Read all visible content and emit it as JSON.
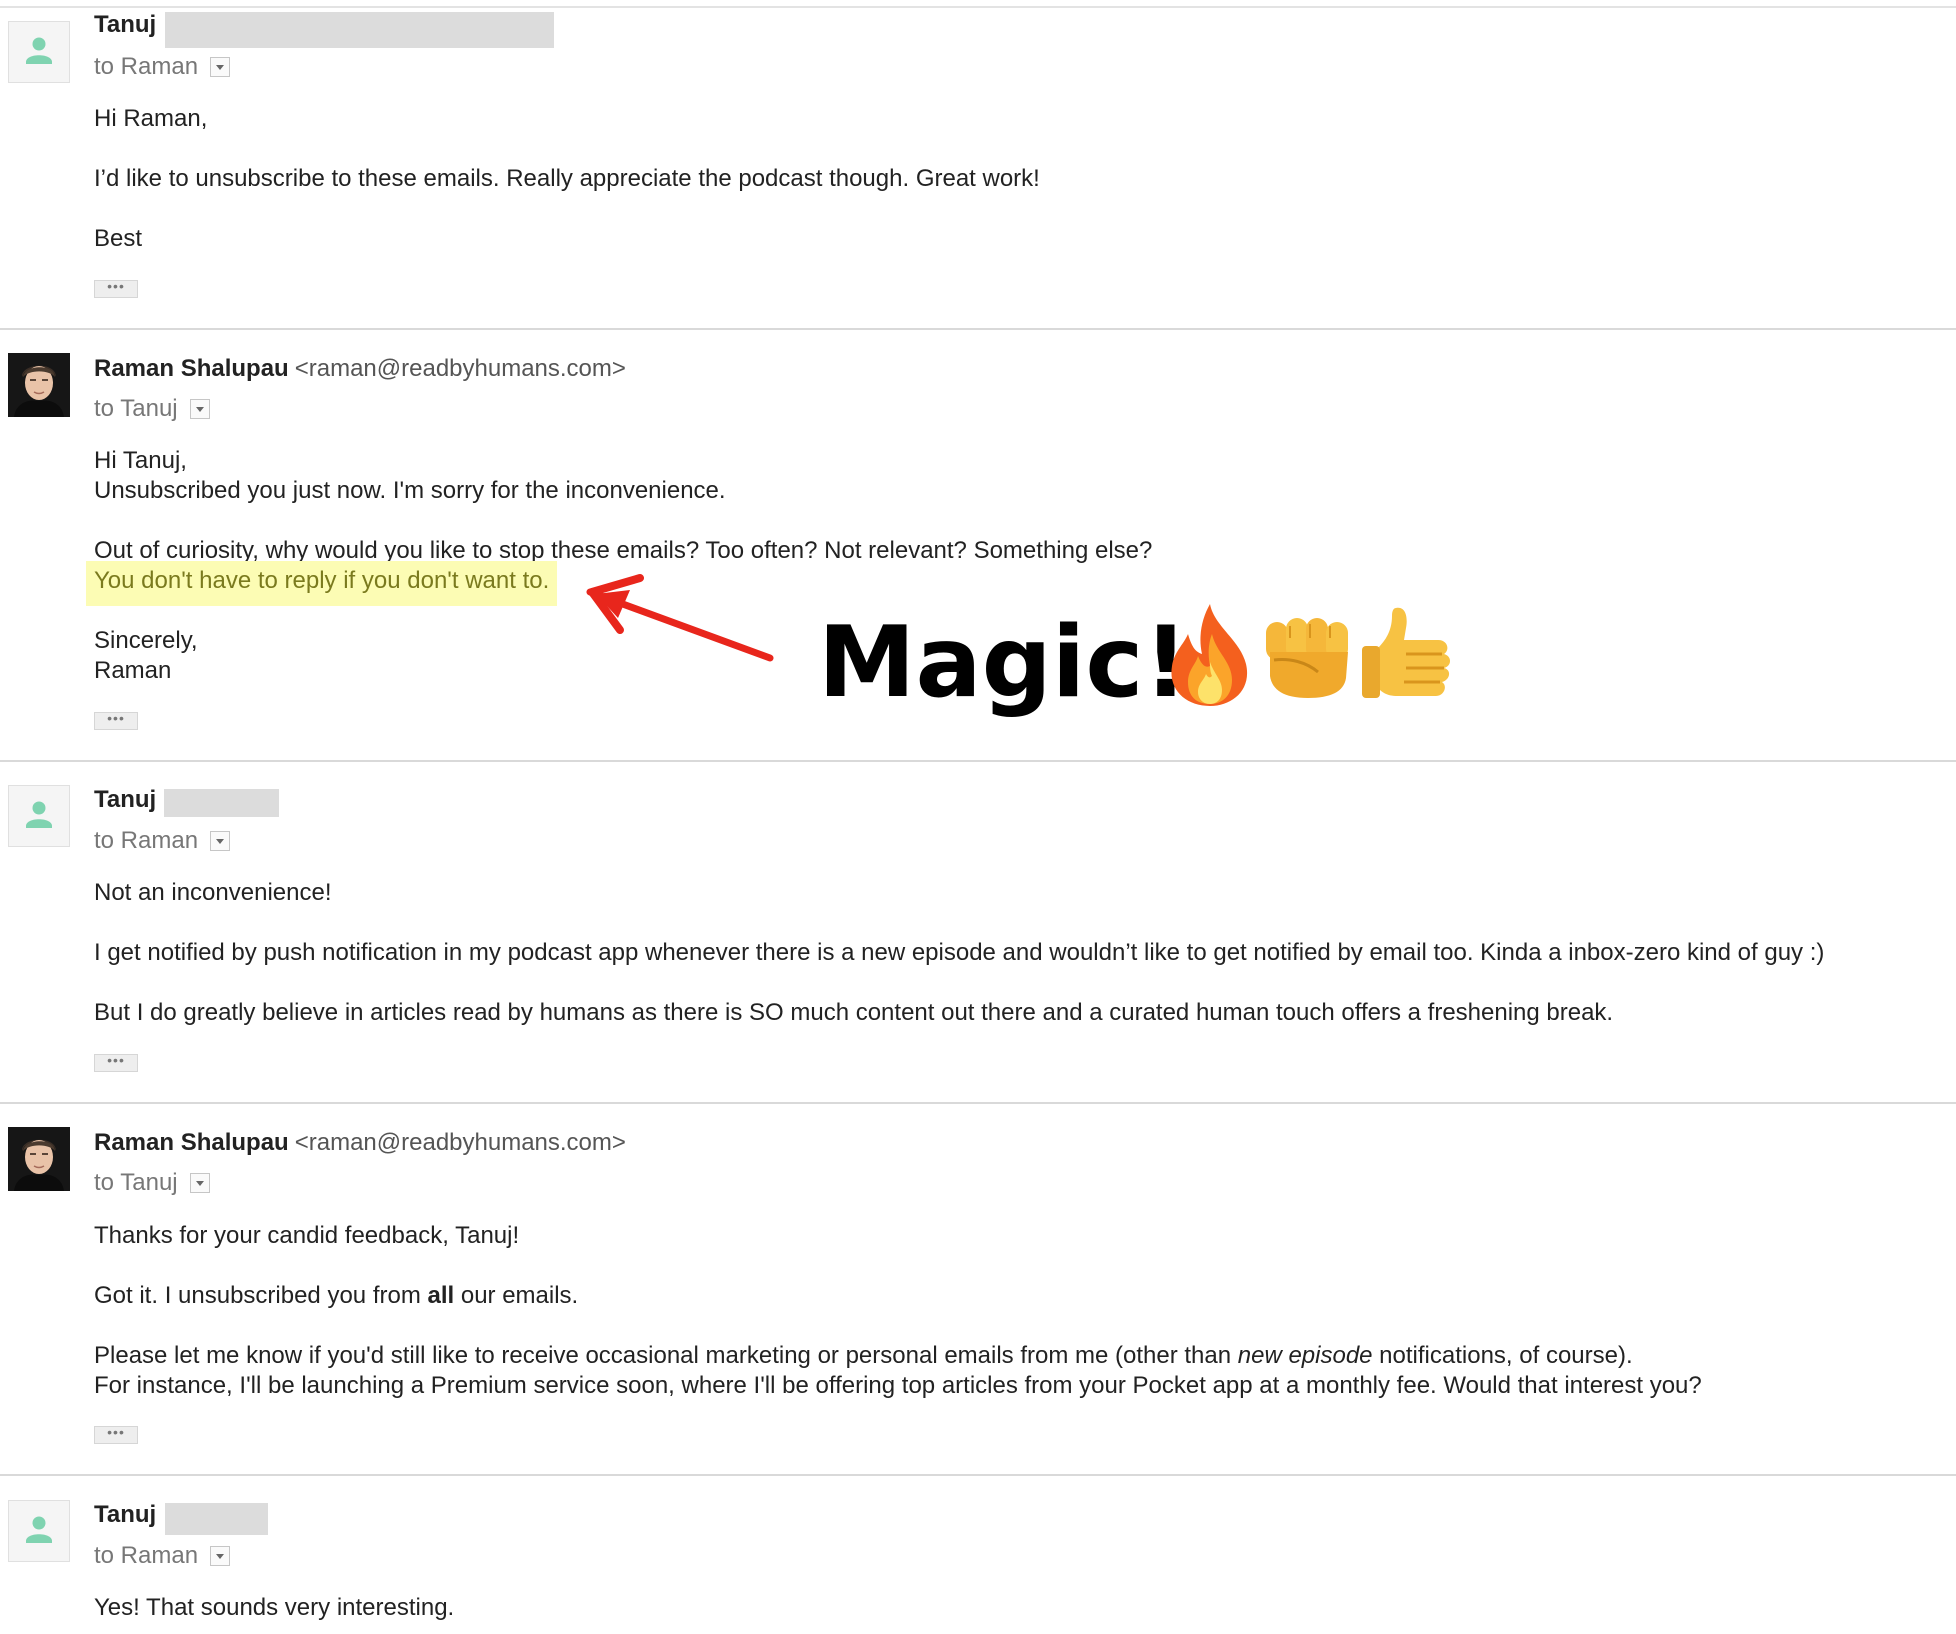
{
  "messages": [
    {
      "sender_name": "Tanuj",
      "sender_email": "",
      "to": "to Raman",
      "body": [
        "Hi Raman,",
        "I’d like to unsubscribe to these emails. Really appreciate the podcast though. Great work!",
        "Best"
      ]
    },
    {
      "sender_name": "Raman Shalupau",
      "sender_email": "<raman@readbyhumans.com>",
      "to": "to Tanuj",
      "body": [
        "Hi Tanuj,",
        "Unsubscribed you just now. I'm sorry for the inconvenience.",
        "Out of curiosity, why would you like to stop these emails? Too often? Not relevant? Something else?",
        "You don't have to reply if you don't want to.",
        "Sincerely,",
        "Raman"
      ]
    },
    {
      "sender_name": "Tanuj",
      "sender_email": "",
      "to": "to Raman",
      "body": [
        "Not an inconvenience!",
        "I get notified by push notification in my podcast app whenever there is a new episode and wouldn’t like to get notified by email too. Kinda a inbox-zero kind of guy :)",
        "But I do greatly believe in articles read by humans as there is SO much content out there and a curated human touch offers a freshening break."
      ]
    },
    {
      "sender_name": "Raman Shalupau",
      "sender_email": "<raman@readbyhumans.com>",
      "to": "to Tanuj",
      "body": [
        "Thanks for your candid feedback, Tanuj!",
        [
          "Got it. I unsubscribed you from ",
          "all",
          " our emails."
        ],
        [
          "Please let me know if you'd still like to receive occasional marketing or personal emails from me (other than ",
          "new episode",
          " notifications, of course)."
        ],
        "For instance, I'll be launching a Premium service soon, where I'll be offering top articles from your Pocket app at a monthly fee. Would that interest you?"
      ]
    },
    {
      "sender_name": "Tanuj",
      "sender_email": "",
      "to": "to Raman",
      "body": [
        "Yes! That sounds very interesting."
      ]
    }
  ],
  "annotation": {
    "text": "Magic!",
    "emojis": [
      "fire-emoji",
      "fist-bump-emoji",
      "thumbs-up-emoji"
    ],
    "arrow_color": "#e8261c"
  },
  "colors": {
    "highlight_bg": "#fcfcb4",
    "highlight_text": "#7a7a1e",
    "avatar_person": "#7fd3b0"
  }
}
